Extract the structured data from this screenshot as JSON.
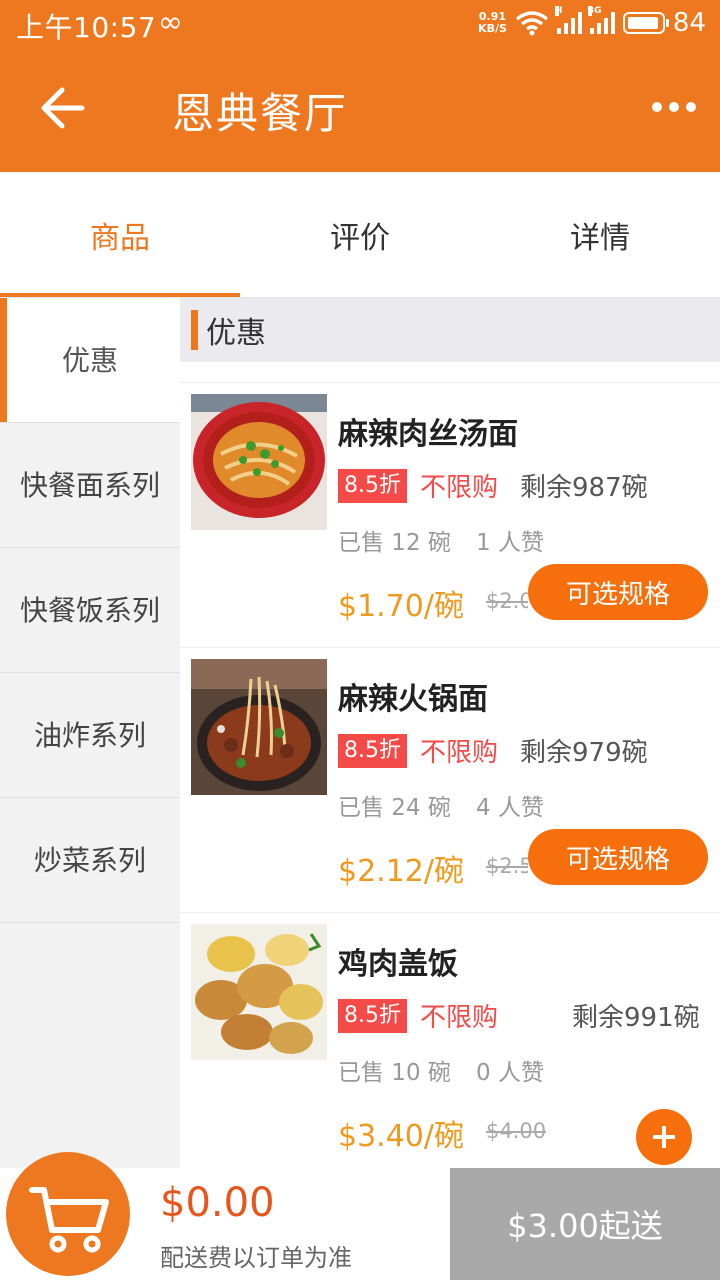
{
  "status_bar": {
    "time": "上午10:57",
    "infinity": "∞",
    "net_speed_value": "0.91",
    "net_speed_unit": "KB/S",
    "signal1_label": "H",
    "signal2_label": "3G",
    "battery": "84"
  },
  "header": {
    "title": "恩典餐厅"
  },
  "tabs": [
    {
      "label": "商品"
    },
    {
      "label": "评价"
    },
    {
      "label": "详情"
    }
  ],
  "sidebar": {
    "items": [
      {
        "label": "优惠"
      },
      {
        "label": "快餐面系列"
      },
      {
        "label": "快餐饭系列"
      },
      {
        "label": "油炸系列"
      },
      {
        "label": "炒菜系列"
      }
    ]
  },
  "section": {
    "title": "优惠"
  },
  "products": [
    {
      "name": "麻辣肉丝汤面",
      "discount": "8.5折",
      "limit": "不限购",
      "stock": "剩余987碗",
      "sold": "已售 12 碗",
      "likes": "1 人赞",
      "price": "$1.70/碗",
      "original_price": "$2.00",
      "action_label": "可选规格"
    },
    {
      "name": "麻辣火锅面",
      "discount": "8.5折",
      "limit": "不限购",
      "stock": "剩余979碗",
      "sold": "已售 24 碗",
      "likes": "4 人赞",
      "price": "$2.12/碗",
      "original_price": "$2.50",
      "action_label": "可选规格"
    },
    {
      "name": "鸡肉盖饭",
      "discount": "8.5折",
      "limit": "不限购",
      "stock": "剩余991碗",
      "sold": "已售 10 碗",
      "likes": "0 人赞",
      "price": "$3.40/碗",
      "original_price": "$4.00",
      "action_icon": "plus-icon"
    }
  ],
  "bottom_bar": {
    "total": "$0.00",
    "delivery_note": "配送费以订单为准",
    "min_order": "$3.00起送"
  },
  "colors": {
    "accent": "#ee781f",
    "discount_red": "#f44a48",
    "price_orange": "#ee9a1f",
    "button_orange": "#f66f0c",
    "disabled_gray": "#a9a9a9"
  }
}
